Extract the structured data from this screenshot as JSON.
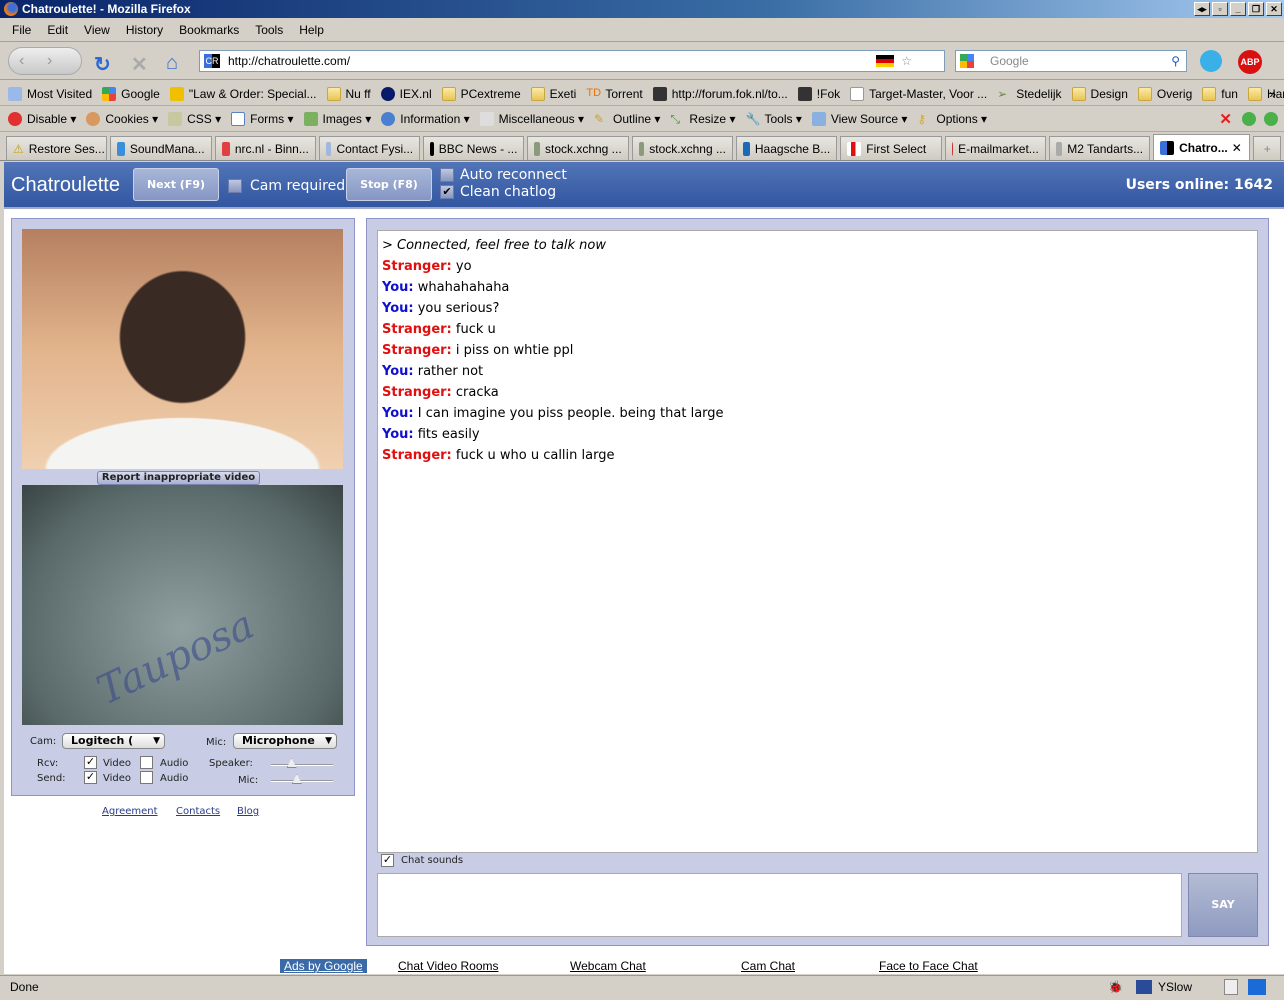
{
  "window": {
    "title": "Chatroulette! - Mozilla Firefox"
  },
  "menu": [
    "File",
    "Edit",
    "View",
    "History",
    "Bookmarks",
    "Tools",
    "Help"
  ],
  "nav": {
    "url": "http://chatroulette.com/",
    "search_placeholder": "Google"
  },
  "bookmarks": [
    "Most Visited",
    "Google",
    "\"Law & Order: Special...",
    "Nu ff",
    "IEX.nl",
    "PCextreme",
    "Exeti",
    "Torrent",
    "http://forum.fok.nl/to...",
    "!Fok",
    "Target-Master, Voor ...",
    "Stedelijk",
    "Design",
    "Overig",
    "fun",
    "Handig"
  ],
  "webdev": [
    "Disable",
    "Cookies",
    "CSS",
    "Forms",
    "Images",
    "Information",
    "Miscellaneous",
    "Outline",
    "Resize",
    "Tools",
    "View Source",
    "Options"
  ],
  "tabs": [
    "Restore Ses...",
    "SoundMana...",
    "nrc.nl - Binn...",
    "Contact Fysi...",
    "BBC News - ...",
    "stock.xchng ...",
    "stock.xchng ...",
    "Haagsche B...",
    "First Select",
    "E-mailmarket...",
    "M2 Tandarts...",
    "Chatro..."
  ],
  "header": {
    "brand": "Chatroulette",
    "next": "Next (F9)",
    "cam_required": "Cam required",
    "stop": "Stop (F8)",
    "auto_reconnect": "Auto reconnect",
    "clean_chatlog": "Clean chatlog",
    "users_online": "Users online: 1642",
    "cam_required_checked": false,
    "auto_reconnect_checked": false,
    "clean_chatlog_checked": true
  },
  "left": {
    "report": "Report inappropriate video",
    "cam_label": "Cam:",
    "cam_value": "Logitech (",
    "mic_label": "Mic:",
    "mic_value": "Microphone",
    "rcv": "Rcv:",
    "send": "Send:",
    "video": "Video",
    "audio": "Audio",
    "speaker": "Speaker:",
    "mic2": "Mic:",
    "speaker_level": 0.3,
    "mic_level": 0.4,
    "links": [
      "Agreement",
      "Contacts",
      "Blog"
    ]
  },
  "chat": {
    "messages": [
      {
        "who": "",
        "text": "> Connected, feel free to talk now"
      },
      {
        "who": "Stranger:",
        "text": " yo"
      },
      {
        "who": "You:",
        "text": " whahahahaha"
      },
      {
        "who": "You:",
        "text": " you serious?"
      },
      {
        "who": "Stranger:",
        "text": " fuck u"
      },
      {
        "who": "Stranger:",
        "text": " i piss on whtie ppl"
      },
      {
        "who": "You:",
        "text": " rather not"
      },
      {
        "who": "Stranger:",
        "text": " cracka"
      },
      {
        "who": "You:",
        "text": " I can imagine you piss people. being that large"
      },
      {
        "who": "You:",
        "text": " fits easily"
      },
      {
        "who": "Stranger:",
        "text": " fuck u who u callin large"
      }
    ],
    "chat_sounds": "Chat sounds",
    "say": "SAY"
  },
  "footer": {
    "ads": "Ads by Google",
    "links": [
      "Chat Video Rooms",
      "Webcam Chat",
      "Cam Chat",
      "Face to Face Chat"
    ]
  },
  "status": {
    "text": "Done",
    "yslow": "YSlow"
  }
}
